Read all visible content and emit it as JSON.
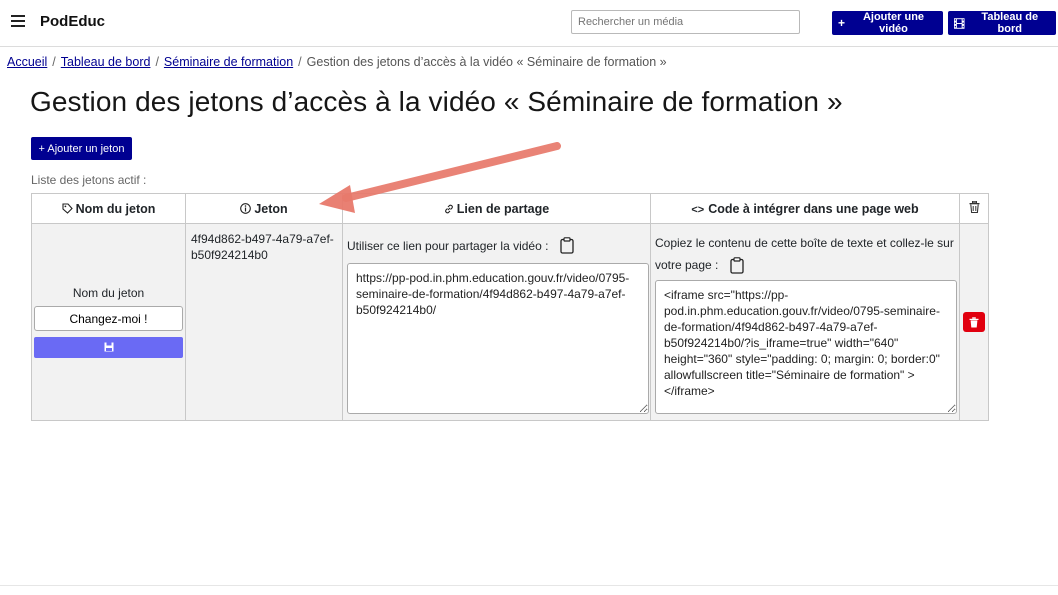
{
  "header": {
    "brand": "PodEduc",
    "search_placeholder": "Rechercher un média",
    "add_video_label": "Ajouter une vidéo",
    "dashboard_label": "Tableau de bord"
  },
  "breadcrumb": {
    "items": [
      "Accueil",
      "Tableau de bord",
      "Séminaire de formation"
    ],
    "current": "Gestion des jetons d’accès à la vidéo « Séminaire de formation »"
  },
  "page": {
    "title": "Gestion des jetons d’accès à la vidéo « Séminaire de formation »",
    "add_token_label": "+ Ajouter un jeton",
    "list_label": "Liste des jetons actif :"
  },
  "table": {
    "headers": {
      "name": "Nom du jeton",
      "token": "Jeton",
      "share_link": "Lien de partage",
      "embed_code": "Code à intégrer dans une page web"
    },
    "row": {
      "name_label": "Nom du jeton",
      "name_value": "Changez-moi !",
      "token": "4f94d862-b497-4a79-a7ef-b50f924214b0",
      "share_label": "Utiliser ce lien pour partager la vidéo :",
      "share_url": "https://pp-pod.in.phm.education.gouv.fr/video/0795-seminaire-de-formation/4f94d862-b497-4a79-a7ef-b50f924214b0/",
      "embed_label": "Copiez le contenu de cette boîte de texte et collez-le sur votre page :",
      "embed_code": "<iframe src=\"https://pp-pod.in.phm.education.gouv.fr/video/0795-seminaire-de-formation/4f94d862-b497-4a79-a7ef-b50f924214b0/?is_iframe=true\" width=\"640\" height=\"360\" style=\"padding: 0; margin: 0; border:0\" allowfullscreen title=\"Séminaire de formation\" ></iframe>"
    }
  },
  "colors": {
    "primary": "#000091",
    "save_button": "#6a6af4",
    "danger": "#e1000f",
    "annotation_arrow": "#e8796b"
  },
  "icons": [
    "menu-icon",
    "plus-icon",
    "film-icon",
    "tag-icon",
    "info-icon",
    "link-icon",
    "code-icon",
    "trash-icon",
    "save-icon",
    "clipboard-icon"
  ]
}
